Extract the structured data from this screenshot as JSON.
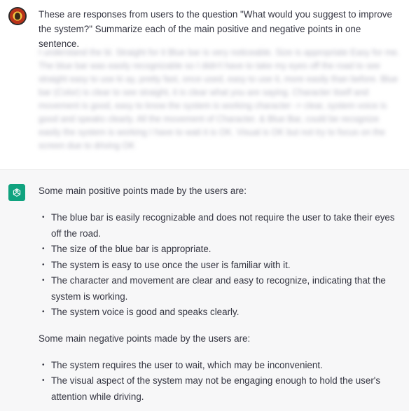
{
  "user": {
    "avatar_icon": "user-avatar-icon",
    "prompt": "These are responses from users to the question \"What would you suggest to improve the system?\" Summarize each of the main positive and negative points in one sentence.",
    "blurred_text": "I understand the bl. Straight for it Blue bar is very noticeable. Size is appropriate Easy for me. The blue bar was easily recognizable so I didn't have to take my eyes off the road to see straight easy to use ki ay, pretty fast, once used, easy to use it, more easily than before. Blue bar (Color) is clear to see straight, it is clear what you are saying. Character itself and movement is good, easy to know the system is working character -> clear, system voice is good and speaks clearly. All the movement of Character. & Blue Bar, could be recognize easily the system is working I have to wait it is OK. Visual is OK but not try to focus on the screen due to driving OK"
  },
  "assistant": {
    "avatar_icon": "openai-logo-icon",
    "intro_positive": "Some main positive points made by the users are:",
    "positive_points": [
      "The blue bar is easily recognizable and does not require the user to take their eyes off the road.",
      "The size of the blue bar is appropriate.",
      "The system is easy to use once the user is familiar with it.",
      "The character and movement are clear and easy to recognize, indicating that the system is working.",
      "The system voice is good and speaks clearly."
    ],
    "intro_negative": "Some main negative points made by the users are:",
    "negative_points": [
      "The system requires the user to wait, which may be inconvenient.",
      "The visual aspect of the system may not be engaging enough to hold the user's attention while driving."
    ]
  },
  "colors": {
    "user_bg": "#ffffff",
    "assistant_bg": "#f7f7f8",
    "brand_green": "#10a37f",
    "text": "#343541"
  }
}
